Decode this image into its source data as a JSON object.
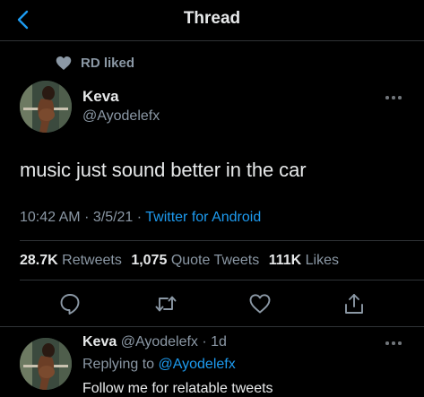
{
  "header": {
    "title": "Thread",
    "back_icon": "chevron-left-icon",
    "accent_color": "#1d9bf0"
  },
  "social_context": {
    "icon": "heart-filled-icon",
    "text": "RD liked"
  },
  "tweet": {
    "display_name": "Keva",
    "handle": "@Ayodelefx",
    "text": "music just sound better in the car",
    "time": "10:42 AM",
    "separator": "·",
    "date": "3/5/21",
    "source": "Twitter for Android",
    "stats": {
      "retweets_count": "28.7K",
      "retweets_label": "Retweets",
      "quotes_count": "1,075",
      "quotes_label": "Quote Tweets",
      "likes_count": "111K",
      "likes_label": "Likes"
    },
    "actions": [
      "reply-icon",
      "retweet-icon",
      "like-icon",
      "share-icon"
    ]
  },
  "reply": {
    "display_name": "Keva",
    "handle": "@Ayodelefx",
    "separator": "·",
    "age": "1d",
    "replying_prefix": "Replying to",
    "replying_to": "@Ayodelefx",
    "text": "Follow me for relatable tweets"
  }
}
